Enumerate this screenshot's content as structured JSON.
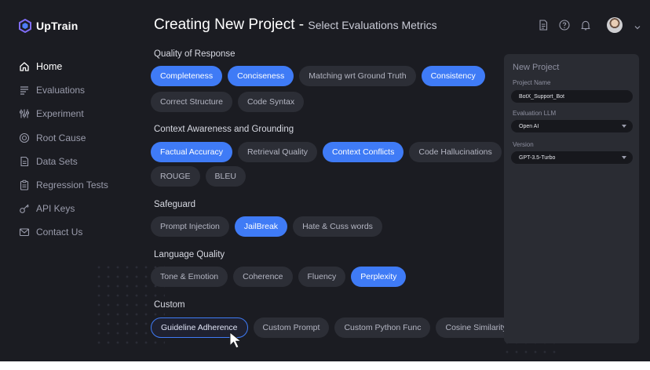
{
  "app": {
    "name": "UpTrain"
  },
  "sidebar": {
    "items": [
      {
        "label": "Home",
        "icon": "home-icon",
        "active": true
      },
      {
        "label": "Evaluations",
        "icon": "list-icon"
      },
      {
        "label": "Experiment",
        "icon": "sliders-icon"
      },
      {
        "label": "Root Cause",
        "icon": "target-icon"
      },
      {
        "label": "Data Sets",
        "icon": "document-icon"
      },
      {
        "label": "Regression Tests",
        "icon": "clipboard-icon"
      },
      {
        "label": "API Keys",
        "icon": "key-icon"
      },
      {
        "label": "Contact Us",
        "icon": "mail-icon"
      }
    ]
  },
  "header": {
    "title": "Creating New Project - ",
    "subtitle": "Select Evaluations Metrics",
    "icons": [
      "document-icon",
      "help-icon",
      "bell-icon",
      "avatar",
      "chevron-down-icon"
    ]
  },
  "sections": [
    {
      "title": "Quality of Response",
      "chips": [
        {
          "label": "Completeness",
          "selected": true
        },
        {
          "label": "Conciseness",
          "selected": true
        },
        {
          "label": "Matching wrt Ground Truth",
          "selected": false
        },
        {
          "label": "Consistency",
          "selected": true
        },
        {
          "label": "Correct Structure",
          "selected": false
        },
        {
          "label": "Code Syntax",
          "selected": false
        }
      ]
    },
    {
      "title": "Context Awareness and Grounding",
      "chips": [
        {
          "label": "Factual Accuracy",
          "selected": true
        },
        {
          "label": "Retrieval Quality",
          "selected": false
        },
        {
          "label": "Context Conflicts",
          "selected": true
        },
        {
          "label": "Code Hallucinations",
          "selected": false
        },
        {
          "label": "ROUGE",
          "selected": false
        },
        {
          "label": "BLEU",
          "selected": false
        }
      ]
    },
    {
      "title": "Safeguard",
      "chips": [
        {
          "label": "Prompt Injection",
          "selected": false
        },
        {
          "label": "JailBreak",
          "selected": true
        },
        {
          "label": "Hate & Cuss words",
          "selected": false
        }
      ]
    },
    {
      "title": "Language Quality",
      "chips": [
        {
          "label": "Tone & Emotion",
          "selected": false
        },
        {
          "label": "Coherence",
          "selected": false
        },
        {
          "label": "Fluency",
          "selected": false
        },
        {
          "label": "Perplexity",
          "selected": true
        }
      ]
    },
    {
      "title": "Custom",
      "chips": [
        {
          "label": "Guideline Adherence",
          "selected": false,
          "focused": true
        },
        {
          "label": "Custom Prompt",
          "selected": false
        },
        {
          "label": "Custom Python Func",
          "selected": false
        },
        {
          "label": "Cosine Similarity",
          "selected": false
        }
      ]
    }
  ],
  "panel": {
    "title": "New Project",
    "project_name_label": "Project Name",
    "project_name_value": "BotX_Support_Bot",
    "llm_label": "Evaluation LLM",
    "llm_value": "Open AI",
    "version_label": "Version",
    "version_value": "GPT-3.5-Turbo"
  },
  "colors": {
    "background": "#1b1c22",
    "chip": "#2c2e36",
    "accent": "#3f7bf6",
    "panel": "#2a2c33"
  }
}
